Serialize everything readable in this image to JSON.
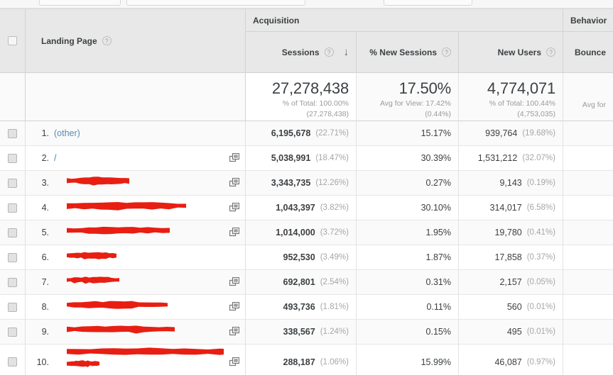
{
  "toolbar": {
    "controls": [
      "control-1",
      "control-2",
      "control-3"
    ]
  },
  "colors": {
    "redaction": "#E81E12",
    "link": "#4285a8",
    "header_bg": "#e8e8e8",
    "text": "#3c4043",
    "muted": "#9a9a9a"
  },
  "table": {
    "group_headers": {
      "blank": "",
      "acquisition": "Acquisition",
      "behavior": "Behavior"
    },
    "dimension_header": {
      "label": "Landing Page",
      "help": "?"
    },
    "metric_headers": [
      {
        "label": "Sessions",
        "help": "?",
        "sorted": true,
        "sort_arrow": "↓"
      },
      {
        "label": "% New Sessions",
        "help": "?",
        "sorted": false
      },
      {
        "label": "New Users",
        "help": "?",
        "sorted": false
      },
      {
        "label": "Bounce",
        "help": "",
        "sorted": false,
        "truncated": true
      }
    ],
    "summary": {
      "sessions": {
        "value": "27,278,438",
        "line1": "% of Total: 100.00%",
        "line2": "(27,278,438)"
      },
      "new_sessions_pct": {
        "value": "17.50%",
        "line1": "Avg for View: 17.42%",
        "line2": "(0.44%)"
      },
      "new_users": {
        "value": "4,774,071",
        "line1": "% of Total: 100.44%",
        "line2": "(4,753,035)"
      },
      "bounce": {
        "value": "",
        "line1": "Avg for",
        "line2": ""
      }
    },
    "rows": [
      {
        "rank": "1.",
        "page": "(other)",
        "redacted": false,
        "has_external_link": false,
        "sessions": "6,195,678",
        "sessions_pct": "(22.71%)",
        "new_sessions_pct": "15.17%",
        "new_users": "939,764",
        "new_users_pct": "(19.68%)"
      },
      {
        "rank": "2.",
        "page": "/",
        "redacted": false,
        "has_external_link": true,
        "sessions": "5,038,991",
        "sessions_pct": "(18.47%)",
        "new_sessions_pct": "30.39%",
        "new_users": "1,531,212",
        "new_users_pct": "(32.07%)"
      },
      {
        "rank": "3.",
        "page": "",
        "redacted": true,
        "has_external_link": true,
        "sessions": "3,343,735",
        "sessions_pct": "(12.26%)",
        "new_sessions_pct": "0.27%",
        "new_users": "9,143",
        "new_users_pct": "(0.19%)"
      },
      {
        "rank": "4.",
        "page": "",
        "redacted": true,
        "has_external_link": true,
        "sessions": "1,043,397",
        "sessions_pct": "(3.82%)",
        "new_sessions_pct": "30.10%",
        "new_users": "314,017",
        "new_users_pct": "(6.58%)"
      },
      {
        "rank": "5.",
        "page": "",
        "redacted": true,
        "has_external_link": true,
        "sessions": "1,014,000",
        "sessions_pct": "(3.72%)",
        "new_sessions_pct": "1.95%",
        "new_users": "19,780",
        "new_users_pct": "(0.41%)"
      },
      {
        "rank": "6.",
        "page": "",
        "redacted": true,
        "has_external_link": false,
        "sessions": "952,530",
        "sessions_pct": "(3.49%)",
        "new_sessions_pct": "1.87%",
        "new_users": "17,858",
        "new_users_pct": "(0.37%)"
      },
      {
        "rank": "7.",
        "page": "",
        "redacted": true,
        "has_external_link": true,
        "sessions": "692,801",
        "sessions_pct": "(2.54%)",
        "new_sessions_pct": "0.31%",
        "new_users": "2,157",
        "new_users_pct": "(0.05%)"
      },
      {
        "rank": "8.",
        "page": "",
        "redacted": true,
        "has_external_link": true,
        "sessions": "493,736",
        "sessions_pct": "(1.81%)",
        "new_sessions_pct": "0.11%",
        "new_users": "560",
        "new_users_pct": "(0.01%)"
      },
      {
        "rank": "9.",
        "page": "",
        "redacted": true,
        "has_external_link": true,
        "sessions": "338,567",
        "sessions_pct": "(1.24%)",
        "new_sessions_pct": "0.15%",
        "new_users": "495",
        "new_users_pct": "(0.01%)"
      },
      {
        "rank": "10.",
        "page": "",
        "redacted": true,
        "has_external_link": true,
        "sessions": "288,187",
        "sessions_pct": "(1.06%)",
        "new_sessions_pct": "15.99%",
        "new_users": "46,087",
        "new_users_pct": "(0.97%)"
      }
    ]
  }
}
